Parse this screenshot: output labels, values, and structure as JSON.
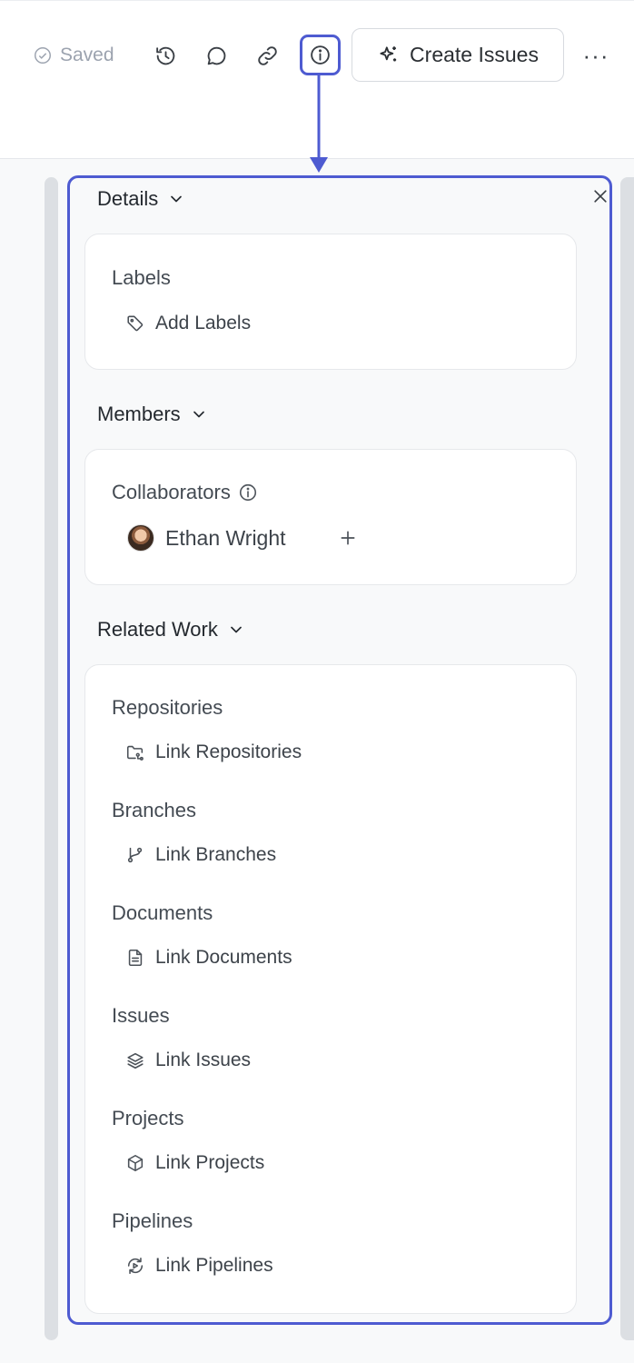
{
  "toolbar": {
    "saved_label": "Saved",
    "create_issues_label": "Create Issues",
    "more_label": "···",
    "accent_color": "#4e5bd1",
    "icons": [
      "check-circle-icon",
      "history-icon",
      "comment-icon",
      "link-icon",
      "info-icon",
      "sparkle-icon",
      "more-icon"
    ]
  },
  "panel": {
    "details": {
      "title": "Details",
      "labels_title": "Labels",
      "add_labels": "Add Labels"
    },
    "members": {
      "title": "Members",
      "collaborators_title": "Collaborators",
      "collaborator_name": "Ethan Wright"
    },
    "related": {
      "title": "Related Work",
      "items": [
        {
          "label": "Repositories",
          "link": "Link Repositories",
          "icon": "repository-icon"
        },
        {
          "label": "Branches",
          "link": "Link Branches",
          "icon": "branch-icon"
        },
        {
          "label": "Documents",
          "link": "Link Documents",
          "icon": "document-icon"
        },
        {
          "label": "Issues",
          "link": "Link Issues",
          "icon": "layers-icon"
        },
        {
          "label": "Projects",
          "link": "Link Projects",
          "icon": "cube-icon"
        },
        {
          "label": "Pipelines",
          "link": "Link Pipelines",
          "icon": "pipeline-icon"
        }
      ]
    }
  }
}
